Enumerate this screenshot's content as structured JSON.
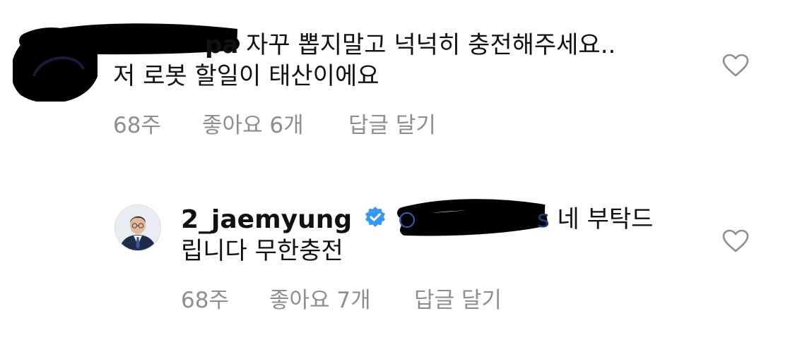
{
  "comment": {
    "username_visible": "pa",
    "line1": "자꾸 뽑지말고 넉넉히 충전해주세요..",
    "line2": "저 로봇 할일이 태산이에요",
    "time": "68주",
    "likes": "좋아요 6개",
    "reply_label": "답글 달기",
    "like_icon": "heart-outline-icon"
  },
  "reply": {
    "username": "2_jaemyung",
    "verified_icon": "verified-badge-icon",
    "mention_tail": "s",
    "line1": "네 부탁드",
    "line2": "립니다 무한충전",
    "time": "68주",
    "likes": "좋아요 7개",
    "reply_label": "답글 달기",
    "like_icon": "heart-outline-icon"
  },
  "colors": {
    "text": "#111111",
    "meta": "#8e8e8e",
    "verified": "#3897f0",
    "redaction": "#000000"
  }
}
